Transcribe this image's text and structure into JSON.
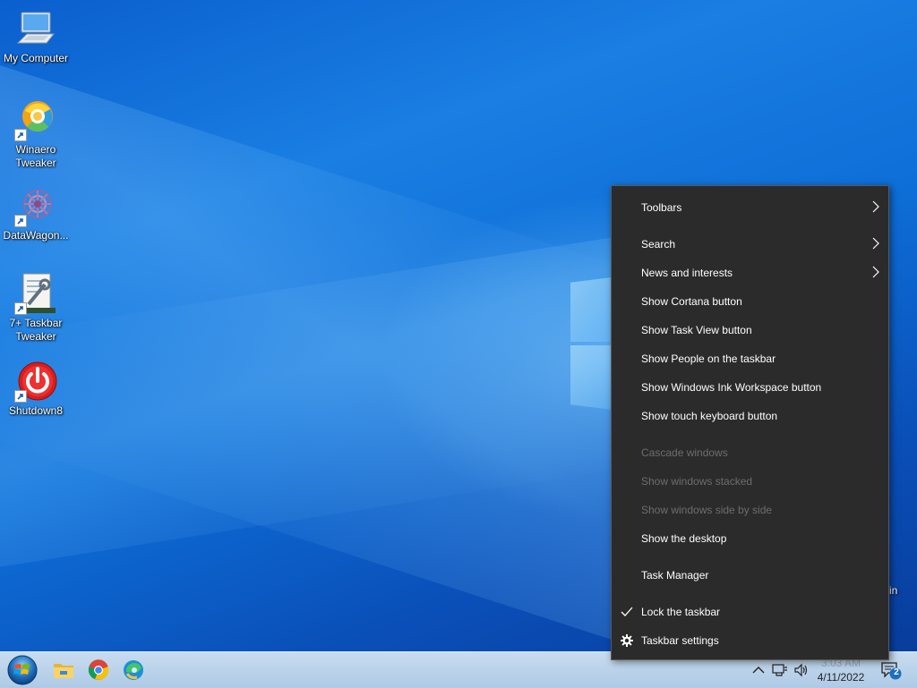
{
  "desktop": {
    "icons": [
      {
        "label": "My Computer",
        "glyph": "computer-icon"
      },
      {
        "label": "Winaero Tweaker",
        "glyph": "winaero-tweaker-icon"
      },
      {
        "label": "DataWagon...",
        "glyph": "datawagon-icon"
      },
      {
        "label": "7+ Taskbar Tweaker",
        "glyph": "taskbar-tweaker-icon"
      },
      {
        "label": "Shutdown8",
        "glyph": "power-icon"
      }
    ],
    "partial_label": "in"
  },
  "context_menu": {
    "items": [
      {
        "label": "Toolbars",
        "submenu": true,
        "enabled": true
      },
      {
        "label": "Search",
        "submenu": true,
        "enabled": true
      },
      {
        "label": "News and interests",
        "submenu": true,
        "enabled": true
      },
      {
        "label": "Show Cortana button",
        "enabled": true
      },
      {
        "label": "Show Task View button",
        "enabled": true
      },
      {
        "label": "Show People on the taskbar",
        "enabled": true
      },
      {
        "label": "Show Windows Ink Workspace button",
        "enabled": true
      },
      {
        "label": "Show touch keyboard button",
        "enabled": true
      },
      {
        "label": "Cascade windows",
        "enabled": false
      },
      {
        "label": "Show windows stacked",
        "enabled": false
      },
      {
        "label": "Show windows side by side",
        "enabled": false
      },
      {
        "label": "Show the desktop",
        "enabled": true
      },
      {
        "label": "Task Manager",
        "enabled": true
      },
      {
        "label": "Lock the taskbar",
        "enabled": true,
        "checked": true
      },
      {
        "label": "Taskbar settings",
        "enabled": true,
        "icon": "gear-icon"
      }
    ]
  },
  "taskbar": {
    "pinned": [
      "start-orb-icon",
      "file-explorer-icon",
      "chrome-icon",
      "edge-icon"
    ],
    "tray": {
      "icons": [
        "chevron-up-icon",
        "network-icon",
        "volume-icon"
      ],
      "time": "3:03 AM",
      "date": "4/11/2022",
      "notification_count": "2"
    }
  },
  "colors": {
    "menu_bg": "#2b2b2b",
    "menu_text": "#ffffff",
    "menu_disabled": "#6d6d6d",
    "taskbar_bg": "#b8d2ea"
  }
}
